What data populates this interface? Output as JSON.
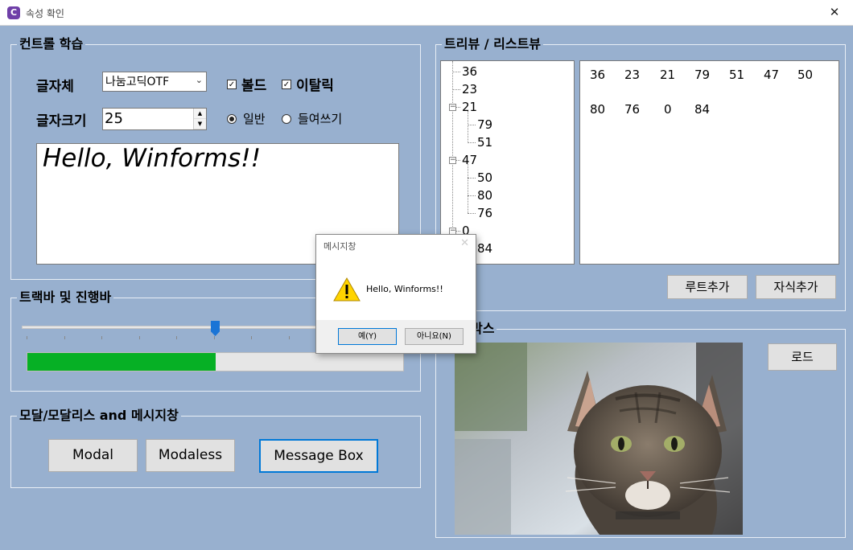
{
  "window": {
    "title": "속성 확인",
    "app_icon": "C",
    "close_glyph": "✕"
  },
  "control_group": {
    "title": "컨트롤 학습",
    "font_label": "글자체",
    "font_combo_value": "나눔고딕OTF",
    "bold_label": "볼드",
    "bold_checked": true,
    "italic_label": "이탈릭",
    "italic_checked": true,
    "size_label": "글자크기",
    "size_value": "25",
    "radio_normal_label": "일반",
    "radio_indent_label": "들여쓰기",
    "radio_selected": "일반",
    "preview_text": "Hello, Winforms!!"
  },
  "trackbar_group": {
    "title": "트랙바 및 진행바",
    "trackbar_value_fraction": 0.5,
    "progress_fraction": 0.5
  },
  "modal_group": {
    "title": "모달/모달리스 and 메시지창",
    "modal_label": "Modal",
    "modaless_label": "Modaless",
    "messagebox_label": "Message Box"
  },
  "tree_group": {
    "title": "트리뷰 / 리스트뷰",
    "tree_nodes": [
      "36",
      "23",
      "21",
      "79",
      "51",
      "47",
      "50",
      "80",
      "76",
      "0",
      "84"
    ],
    "list_items_row1": [
      "36",
      "23",
      "21",
      "79",
      "51",
      "47",
      "50"
    ],
    "list_items_row2": [
      "80",
      "76",
      "0",
      "84"
    ],
    "add_root_label": "루트추가",
    "add_child_label": "자식추가"
  },
  "picture_group": {
    "title_visible": "박스",
    "load_label": "로드",
    "image_subject": "tabby cat"
  },
  "message_box": {
    "title": "메시지창",
    "close_glyph": "✕",
    "icon": "warning-icon",
    "message": "Hello, Winforms!!",
    "yes_label": "예(Y)",
    "no_label": "아니요(N)"
  },
  "colors": {
    "form_background": "#98b0cf",
    "progress_fill": "#06b025",
    "accent": "#0078d7"
  }
}
